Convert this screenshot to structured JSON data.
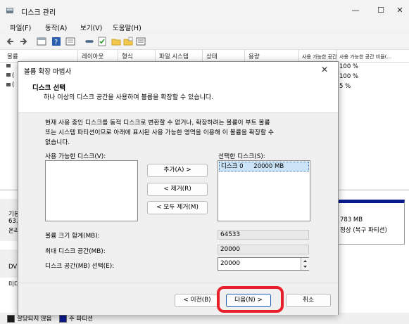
{
  "window": {
    "title": "디스크 관리",
    "minimize": "—",
    "maximize": "☐",
    "close": "✕"
  },
  "menu": [
    "파일(F)",
    "동작(A)",
    "보기(V)",
    "도움말(H)"
  ],
  "columns": [
    "볼륨",
    "레이아웃",
    "형식",
    "파일 시스템",
    "상태",
    "용량",
    "사용 가능한 공간",
    "사용 가능한 공간 비율(..."
  ],
  "volumes": [
    {
      "name": "(",
      "free_pct": "100 %"
    },
    {
      "name": "(",
      "free_pct": "100 %"
    },
    {
      "name": "(",
      "free_pct": "5 %"
    }
  ],
  "lower": {
    "disk_label_1": "기본",
    "disk_label_2": "63.",
    "disk_label_3": "온라",
    "partition_size": "783 MB",
    "partition_status": "정상 (복구 파티션)",
    "dvd_label": "DVD",
    "removable_label": "미디"
  },
  "legend": {
    "unallocated": "할당되지 않음",
    "primary": "주 파티션",
    "unallocated_color": "#1a1a1a",
    "primary_color": "#0a1a8c"
  },
  "dialog": {
    "title": "볼륨 확장 마법사",
    "close": "✕",
    "heading": "디스크 선택",
    "subheading": "하나 이상의 디스크 공간을 사용하여 볼륨을 확장할 수 있습니다.",
    "description": [
      "현재 사용 중인 디스크를 동적 디스크로 변환할 수 없거나, 확장하려는 볼륨이 부트 볼륨",
      "또는 시스템 파티션이므로 아래에 표시된 사용 가능한 영역을 이용해 이 볼륨을 확장할 수",
      "없습니다."
    ],
    "available_label": "사용 가능한 디스크(V):",
    "selected_label": "선택한 디스크(S):",
    "selected_items": [
      {
        "disk": "디스크 0",
        "size": "20000 MB"
      }
    ],
    "add_button": "추가(A) >",
    "remove_button": "< 제거(R)",
    "remove_all_button": "< 모두 제거(M)",
    "total_label": "볼륨 크기 합계(MB):",
    "total_value": "64533",
    "max_label": "최대 디스크 공간(MB):",
    "max_value": "20000",
    "select_label": "디스크 공간(MB) 선택(E):",
    "select_value": "20000",
    "back_button": "< 이전(B)",
    "next_button": "다음(N) >",
    "cancel_button": "취소"
  },
  "colors": {
    "highlight": "#e8202a",
    "selection": "#cce4f7"
  }
}
